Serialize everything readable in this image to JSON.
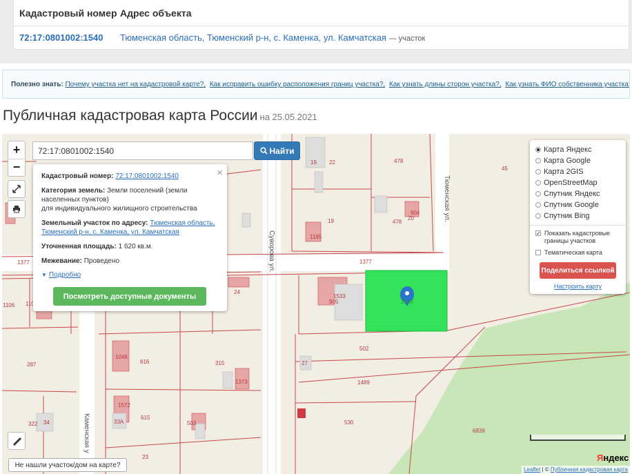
{
  "result": {
    "header_cadastral": "Кадастровый номер",
    "header_address": "Адрес объекта",
    "cadastral_number": "72:17:0801002:1540",
    "address": "Тюменская область, Тюменский р-н, с. Каменка, ул. Камчатская",
    "address_suffix": "— участок"
  },
  "useful": {
    "label": "Полезно знать:",
    "links": [
      "Почему участка нет на кадастровой карте?,",
      "Как исправить ошибку расположения границ участка?,",
      "Как узнать длины сторон участка?,",
      "Как узнать ФИО собственника участка?"
    ]
  },
  "page": {
    "title": "Публичная кадастровая карта России",
    "date": "на 25.05.2021"
  },
  "map": {
    "zoom_in": "+",
    "zoom_out": "−",
    "search_value": "72:17:0801002:1540",
    "search_button": "Найти",
    "popup": {
      "close": "×",
      "cadastral_label": "Кадастровый номер:",
      "cadastral_value": "72:17:0801002:1540",
      "category_label": "Категория земель:",
      "category_value": "Земли поселений (земли населенных пунктов)",
      "category_value2": "для индивидуального жилищного строительства",
      "address_label": "Земельный участок по адресу:",
      "address_value": "Тюменская область, Тюменский р-н, с. Каменка, ул. Камчатская",
      "area_label": "Уточненная площадь:",
      "area_value": "1 620 кв.м.",
      "survey_label": "Межевание:",
      "survey_value": "Проведено",
      "more": "Подробно",
      "docs_button": "Посмотреть доступные документы"
    },
    "layers": {
      "options": [
        "Карта Яндекс",
        "Карта Google",
        "Карта 2GIS",
        "OpenStreetMap",
        "Спутник Яндекс",
        "Спутник Google",
        "Спутник Bing"
      ],
      "selected": 0,
      "check1": "Показать кадастровые границы участков",
      "check2": "Тематическая карта",
      "share_button": "Поделиться ссылкой",
      "setup_link": "Настроить карту"
    },
    "not_found": "Не нашли участок/дом на карте?",
    "attribution_leaflet": "Leaflet",
    "attribution_sep": " | © ",
    "attribution_source": "Публичная кадастровая карта",
    "yandex_logo_y": "Я",
    "yandex_logo_rest": "ндекс",
    "street_labels": [
      "Тюменская ул.",
      "Суворова ул.",
      "Каменская у"
    ],
    "parcel_labels": [
      "19",
      "22",
      "478",
      "45",
      "904",
      "476",
      "20",
      "19",
      "1195",
      "1377",
      "1377",
      "905",
      "1533",
      "24",
      "1106",
      "110",
      "287",
      "1048",
      "616",
      "315",
      "1373",
      "502",
      "27",
      "1489",
      "322",
      "34",
      "1572",
      "33А",
      "615",
      "503",
      "530",
      "23",
      "6839",
      "1540"
    ],
    "colors": {
      "highlight": "#33e45a",
      "parcel_line": "#c8474a",
      "forest": "#c8e6b8"
    }
  }
}
